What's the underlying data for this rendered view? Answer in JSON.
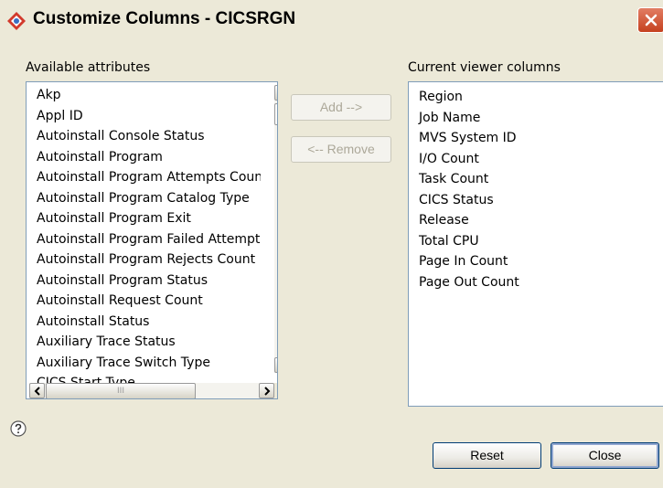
{
  "window": {
    "title": "Customize Columns - CICSRGN"
  },
  "available": {
    "label": "Available attributes",
    "items": [
      "Akp",
      "Appl ID",
      "Autoinstall Console Status",
      "Autoinstall Program",
      "Autoinstall Program Attempts Count",
      "Autoinstall Program Catalog Type",
      "Autoinstall Program Exit",
      "Autoinstall Program Failed Attempts",
      "Autoinstall Program Rejects Count",
      "Autoinstall Program Status",
      "Autoinstall Request Count",
      "Autoinstall Status",
      "Auxiliary Trace Status",
      "Auxiliary Trace Switch Type",
      "CICS Start Type"
    ]
  },
  "current": {
    "label": "Current viewer columns",
    "items": [
      "Region",
      "Job Name",
      "MVS System ID",
      "I/O Count",
      "Task Count",
      "CICS Status",
      "Release",
      "Total CPU",
      "Page In Count",
      "Page Out Count"
    ]
  },
  "buttons": {
    "add": "Add -->",
    "remove": "<-- Remove",
    "reset": "Reset",
    "close": "Close"
  },
  "scrollbar": {
    "grip": "III"
  },
  "icons": {
    "app": "cics-region-icon",
    "close_window": "close-icon",
    "help": "help-icon",
    "up": "arrow-up-icon",
    "down": "arrow-down-icon",
    "left": "arrow-left-icon",
    "right": "arrow-right-icon"
  },
  "colors": {
    "dialog_bg": "#ece9d8",
    "list_border": "#7f9db9",
    "close_button": "#c5411f",
    "button_border": "#003c74"
  }
}
